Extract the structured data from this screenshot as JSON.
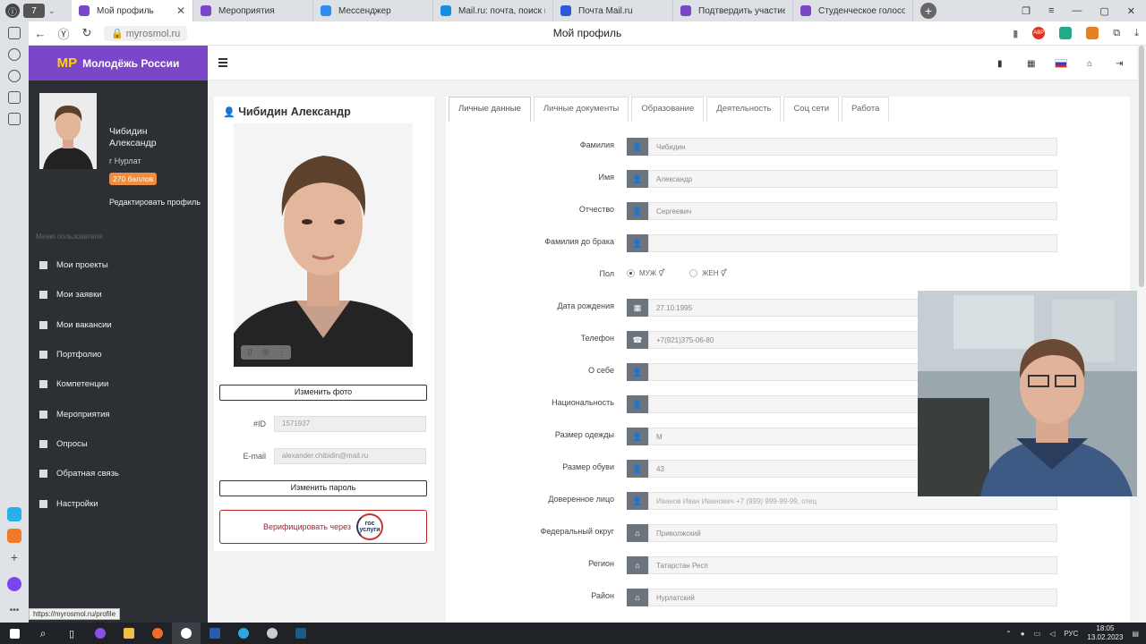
{
  "browser": {
    "tab_counter": "7",
    "tabs": [
      {
        "label": "Мой профиль",
        "color": "#7b46c7",
        "active": true
      },
      {
        "label": "Мероприятия",
        "color": "#7b46c7",
        "active": false
      },
      {
        "label": "Мессенджер",
        "color": "#2d8cf0",
        "active": false
      },
      {
        "label": "Mail.ru: почта, поиск в ин",
        "color": "#168de2",
        "active": false
      },
      {
        "label": "Почта Mail.ru",
        "color": "#2a5ad8",
        "active": false
      },
      {
        "label": "Подтвердить участие",
        "color": "#7b46c7",
        "active": false
      },
      {
        "label": "Студенческое голосование",
        "color": "#7b46c7",
        "active": false
      }
    ],
    "url": "myrosmol.ru",
    "page_title": "Мой профиль",
    "status_url": "https://myrosmol.ru/profile"
  },
  "brand": {
    "mark": "МР",
    "name": "Молодёжь России",
    "color": "#7b46c7"
  },
  "user": {
    "first_line": "Чибидин",
    "second_line": "Александр",
    "city": "г Нурлат",
    "points": "270 баллов",
    "edit_label": "Редактировать профиль"
  },
  "menu": {
    "heading": "Меню пользователя",
    "items": [
      {
        "label": "Мои проекты",
        "icon": "book-icon"
      },
      {
        "label": "Мои заявки",
        "icon": "bookmark-icon"
      },
      {
        "label": "Мои вакансии",
        "icon": "list-icon"
      },
      {
        "label": "Портфолио",
        "icon": "folder-icon"
      },
      {
        "label": "Компетенции",
        "icon": "list-icon"
      },
      {
        "label": "Мероприятия",
        "icon": "sitemap-icon"
      },
      {
        "label": "Опросы",
        "icon": "question-icon"
      },
      {
        "label": "Обратная связь",
        "icon": "envelope-icon"
      },
      {
        "label": "Настройки",
        "icon": "gear-icon"
      }
    ]
  },
  "profile_card": {
    "name": "Чибидин Александр",
    "change_photo": "Изменить фото",
    "id_label": "#ID",
    "id_value": "1571937",
    "email_label": "E-mail",
    "email_value": "alexander.chibidin@mail.ru",
    "change_password": "Изменить пароль",
    "verify_label": "Верифицировать через",
    "gos_logo": "гос услуги"
  },
  "form": {
    "tabs": [
      "Личные данные",
      "Личные документы",
      "Образование",
      "Деятельность",
      "Соц сети",
      "Работа"
    ],
    "fields": [
      {
        "label": "Фамилия",
        "value": "Чибидин",
        "icon": "user-icon"
      },
      {
        "label": "Имя",
        "value": "Александр",
        "icon": "user-icon"
      },
      {
        "label": "Отчество",
        "value": "Сергеевич",
        "icon": "user-icon"
      },
      {
        "label": "Фамилия до брака",
        "value": "",
        "icon": "user-icon"
      },
      {
        "label": "Пол",
        "value": "",
        "icon": ""
      },
      {
        "label": "Дата рождения",
        "value": "27.10.1995",
        "icon": "calendar-icon"
      },
      {
        "label": "Телефон",
        "value": "+7(921)375-06-80",
        "icon": "phone-icon"
      },
      {
        "label": "О себе",
        "value": "",
        "icon": "user-icon"
      },
      {
        "label": "Национальность",
        "value": "",
        "icon": "user-icon"
      },
      {
        "label": "Размер одежды",
        "value": "M",
        "icon": "user-icon"
      },
      {
        "label": "Размер обуви",
        "value": "43",
        "icon": "user-icon"
      },
      {
        "label": "Доверенное лицо",
        "value": "",
        "placeholder": "Иванов Иван Иванович +7 (999) 999-99-99, отец",
        "icon": "user-icon"
      },
      {
        "label": "Федеральный округ",
        "value": "Приволжский",
        "icon": "home-icon"
      },
      {
        "label": "Регион",
        "value": "Татарстан Респ",
        "icon": "home-icon"
      },
      {
        "label": "Район",
        "value": "Нурлатский",
        "icon": "home-icon"
      }
    ],
    "gender_male": "МУЖ",
    "gender_female": "ЖЕН"
  },
  "taskbar": {
    "lang": "РУС",
    "time": "18:05",
    "date": "13.02.2023"
  }
}
